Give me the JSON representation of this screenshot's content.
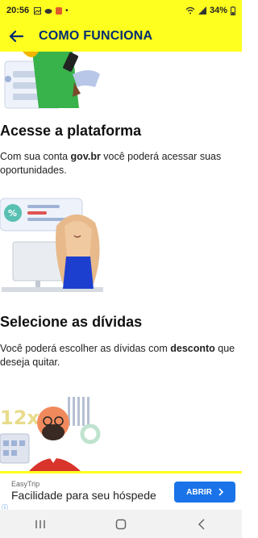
{
  "status_bar": {
    "time": "20:56",
    "battery": "34%"
  },
  "app_bar": {
    "back_icon": "arrow-back-icon",
    "title": "COMO FUNCIONA"
  },
  "sections": [
    {
      "title": "Acesse a plataforma",
      "text_before": "Com sua conta ",
      "text_bold": "gov.br",
      "text_after": " você poderá acessar suas oportunidades."
    },
    {
      "title": "Selecione as dívidas",
      "text_before": "Você poderá escolher as dívidas com ",
      "text_bold": "desconto",
      "text_after": " que deseja quitar."
    }
  ],
  "illustration_3": {
    "number_text": "12x"
  },
  "ad": {
    "brand": "EasyTrip",
    "text": "Facilidade para seu hóspede",
    "button_label": "ABRIR",
    "button_icon": "chevron-right-icon",
    "info_icon": "ad-info-icon"
  },
  "colors": {
    "accent_yellow": "#ffff1f",
    "title_blue": "#002c72",
    "ad_blue": "#1a73e8"
  }
}
